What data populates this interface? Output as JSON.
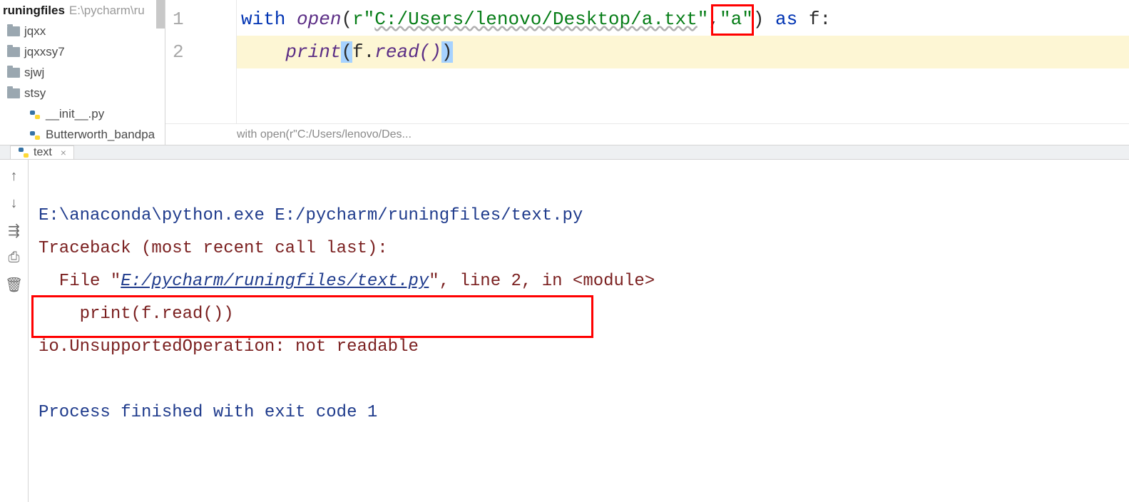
{
  "tree": {
    "root_name": "runingfiles",
    "root_path": "E:\\pycharm\\ru",
    "items": [
      {
        "name": "jqxx",
        "type": "folder",
        "indent": 1
      },
      {
        "name": "jqxxsy7",
        "type": "folder",
        "indent": 1
      },
      {
        "name": "sjwj",
        "type": "folder",
        "indent": 1
      },
      {
        "name": "stsy",
        "type": "folder",
        "indent": 1
      },
      {
        "name": "__init__.py",
        "type": "python",
        "indent": 2
      },
      {
        "name": "Butterworth_bandpa",
        "type": "python",
        "indent": 2
      }
    ]
  },
  "editor": {
    "line_numbers": [
      "1",
      "2"
    ],
    "l1": {
      "kw_with": "with",
      "sp1": " ",
      "fn_open": "open",
      "lp": "(",
      "str1": "r\"",
      "path": "C:/Users/lenovo/Desktop/a.txt",
      "str1_end": "\"",
      "comma": ",",
      "str_mode": "\"a\"",
      "rp": ")",
      "sp2": " ",
      "kw_as": "as",
      "sp3": " ",
      "var": "f",
      "colon": ":"
    },
    "l2": {
      "indent": "    ",
      "fn_print": "print",
      "lp": "(",
      "selA": "f",
      "dot": ".",
      "readcall": "read()",
      "selB": ")"
    },
    "breadcrumb": "with open(r\"C:/Users/lenovo/Des..."
  },
  "run_tab": {
    "name": "text",
    "close": "×"
  },
  "console": {
    "cmd": "E:\\anaconda\\python.exe E:/pycharm/runingfiles/text.py",
    "trace1": "Traceback (most recent call last):",
    "file_prefix": "  File \"",
    "file_link": "E:/pycharm/runingfiles/text.py",
    "file_suffix": "\", line 2, in <module>",
    "code_line": "    print(f.read())",
    "error": "io.UnsupportedOperation: not readable",
    "exit": "Process finished with exit code 1"
  },
  "tools": {
    "up": "↑",
    "down": "↓",
    "wrap": "⇶",
    "print": "⎙",
    "trash": "🗑"
  }
}
